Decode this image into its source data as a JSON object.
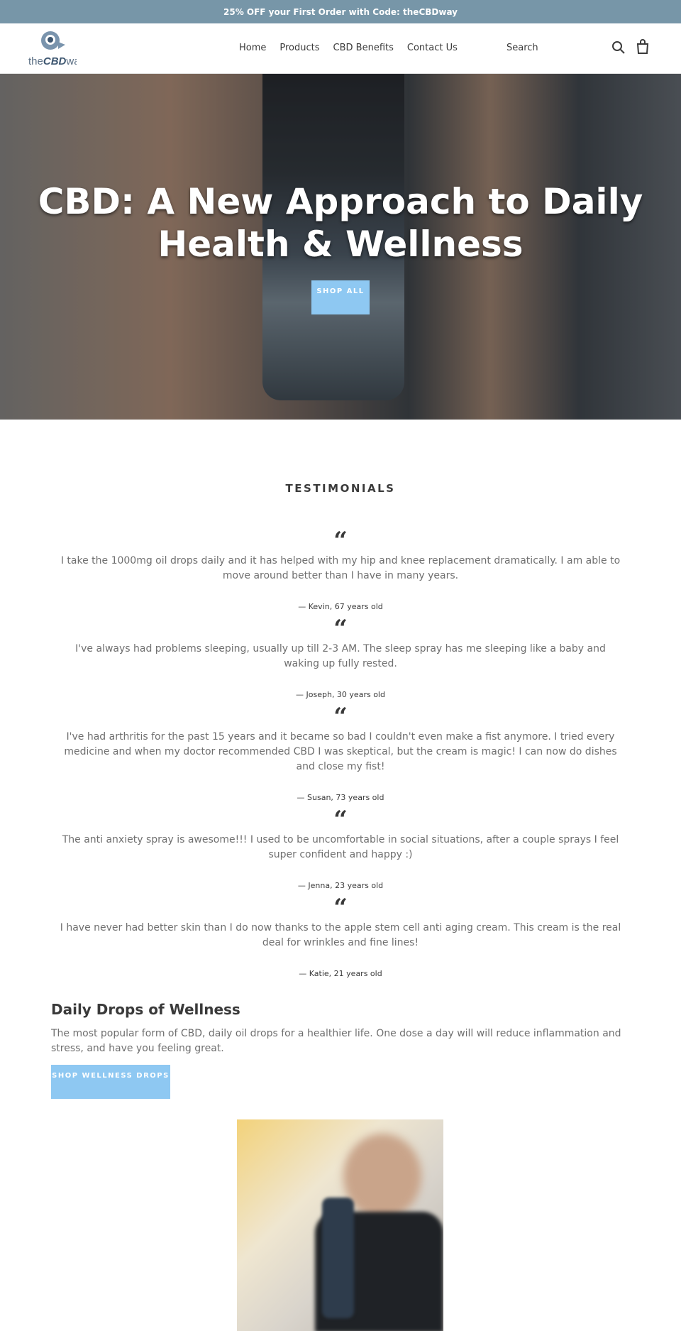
{
  "announcement": "25% OFF your First Order with Code: theCBDway",
  "header": {
    "logo": "theCBDway",
    "nav": [
      "Home",
      "Products",
      "CBD Benefits",
      "Contact Us"
    ],
    "search_label": "Search"
  },
  "hero": {
    "title": "CBD: A New Approach to Daily Health & Wellness",
    "button": "SHOP ALL"
  },
  "testimonials": {
    "heading": "TESTIMONIALS",
    "items": [
      {
        "quote": "I take the 1000mg oil drops daily and it has helped with my hip and knee replacement dramatically. I am able to move around better than I have in many years.",
        "author": "— Kevin, 67 years old"
      },
      {
        "quote": "I've always had problems sleeping, usually up till 2-3 AM. The sleep spray has me sleeping like a baby and waking up fully rested.",
        "author": "— Joseph, 30 years old"
      },
      {
        "quote": "I've had arthritis for the past 15 years and it became so bad I couldn't even make a fist anymore. I tried every medicine and when my doctor recommended CBD I was skeptical, but the cream is magic! I can now do dishes and close my fist!",
        "author": "— Susan, 73 years old"
      },
      {
        "quote": "The anti anxiety spray is awesome!!! I used to be uncomfortable in social situations, after a couple sprays I feel super confident and happy :)",
        "author": "— Jenna, 23 years old"
      },
      {
        "quote": "I have never had better skin than I do now thanks to the apple stem cell anti aging cream. This cream is the real deal for wrinkles and fine lines!",
        "author": "— Katie, 21 years old"
      }
    ]
  },
  "feature": {
    "title": "Daily Drops of Wellness",
    "text": "The most popular form of CBD, daily oil drops for a healthier life. One dose a day will will reduce inflammation and stress, and have you feeling great.",
    "button": "SHOP WELLNESS DROPS"
  },
  "colors": {
    "banner": "#7796a8",
    "button": "#8ec8f2"
  }
}
